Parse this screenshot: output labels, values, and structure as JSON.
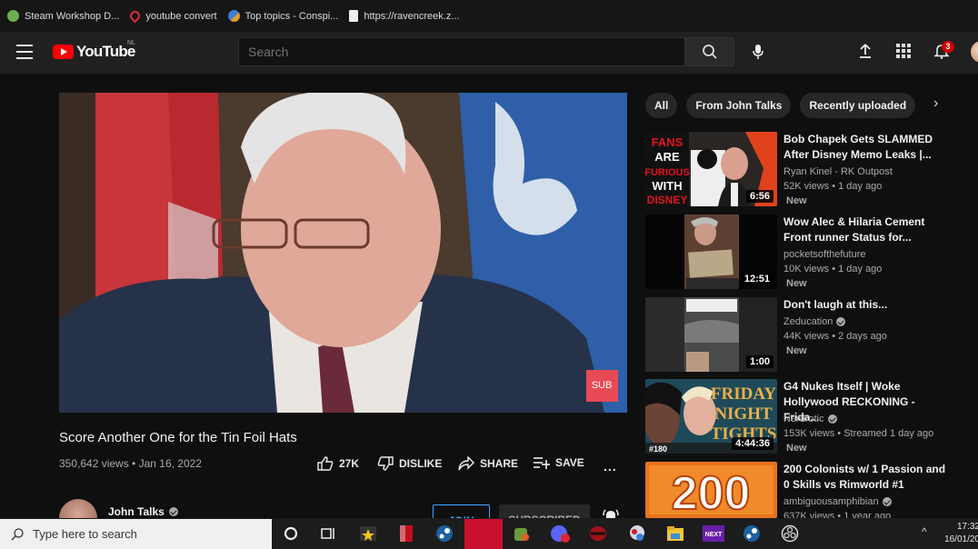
{
  "bookmarks": [
    {
      "label": "Steam Workshop D...",
      "icon": "steam-icon"
    },
    {
      "label": "youtube convert",
      "icon": "location-pin-icon"
    },
    {
      "label": "Top topics - Conspi...",
      "icon": "forum-icon"
    },
    {
      "label": "https://ravencreek.z...",
      "icon": "document-icon"
    }
  ],
  "header": {
    "logo_text": "YouTube",
    "country_code": "NL",
    "search_placeholder": "Search",
    "notification_count": "3"
  },
  "video": {
    "title": "Score Another One for the Tin Foil Hats",
    "views": "350,642 views",
    "date": "Jan 16, 2022",
    "meta": "350,642 views • Jan 16, 2022",
    "likes": "27K",
    "dislike_label": "DISLIKE",
    "share_label": "SHARE",
    "save_label": "SAVE",
    "more_label": "...",
    "watermark": "SUB"
  },
  "channel": {
    "name": "John Talks",
    "join_label": "JOIN",
    "subscribed_label": "SUBSCRIBED"
  },
  "sidebar": {
    "chips": [
      {
        "label": "All",
        "active": true
      },
      {
        "label": "From John Talks",
        "active": false
      },
      {
        "label": "Recently uploaded",
        "active": false
      }
    ],
    "recommendations": [
      {
        "title_line1": "Bob Chapek Gets SLAMMED",
        "title_line2": "After Disney Memo Leaks |...",
        "channel": "Ryan Kinel - RK Outpost",
        "verified": false,
        "views": "52K views • 1 day ago",
        "badge": "New",
        "duration": "6:56",
        "thumb_text": "FANS ARE FURIOUS WITH DISNEY"
      },
      {
        "title_line1": "Wow Alec & Hilaria Cement",
        "title_line2": "Front runner Status for...",
        "channel": "pocketsofthefuture",
        "verified": false,
        "views": "10K views • 1 day ago",
        "badge": "New",
        "duration": "12:51"
      },
      {
        "title_line1": "Don't laugh at this...",
        "title_line2": "",
        "channel": "Zeducation",
        "verified": true,
        "views": "44K views • 2 days ago",
        "badge": "New",
        "duration": "1:00"
      },
      {
        "title_line1": "G4 Nukes Itself | Woke",
        "title_line2": "Hollywood RECKONING - Frida...",
        "channel": "Nerdrotic",
        "verified": true,
        "views": "153K views • Streamed 1 day ago",
        "badge": "New",
        "duration": "4:44:36",
        "thumb_text": "FRIDAY NIGHT TIGHTS",
        "thumb_episode": "#180"
      },
      {
        "title_line1": "200 Colonists w/ 1 Passion and",
        "title_line2": "0 Skills vs Rimworld #1",
        "channel": "ambiguousamphibian",
        "verified": true,
        "views": "637K views • 1 year ago",
        "badge": "",
        "duration": "",
        "thumb_text": "200"
      }
    ]
  },
  "taskbar": {
    "search_placeholder": "Type here to search",
    "time": "17:32",
    "date": "16/01/20",
    "apps": [
      "cortana-icon",
      "task-view-icon",
      "movie-maker-icon",
      "red-app-icon",
      "steam-icon",
      "active-red-app-icon",
      "shop-icon",
      "discord-icon",
      "red-sphere-icon",
      "bubble-app-icon",
      "file-explorer-icon",
      "next-app-icon",
      "steam-alt-icon",
      "obs-icon"
    ]
  },
  "colors": {
    "accent_red": "#ff0000",
    "link_blue": "#3ea6ff",
    "background": "#0f0f0f",
    "header": "#202020"
  }
}
